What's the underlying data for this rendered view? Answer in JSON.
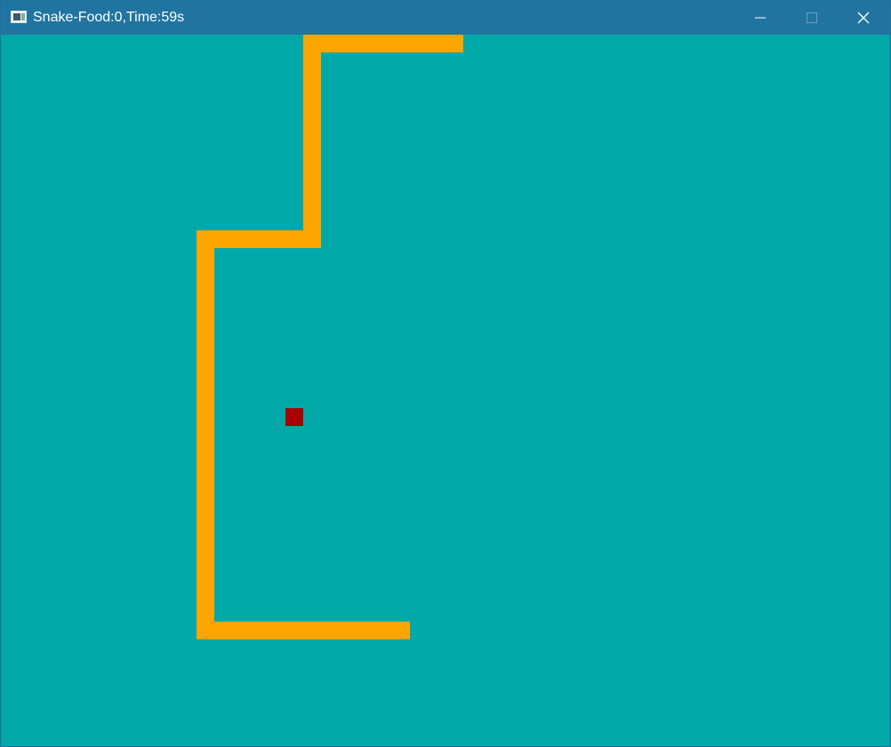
{
  "window": {
    "title": "Snake-Food:0,Time:59s",
    "icon": "app-window-icon",
    "controls": [
      "minimize-icon",
      "maximize-icon",
      "close-icon"
    ]
  },
  "colors": {
    "titlebar": "#2174A0",
    "background": "#00A8A8",
    "snake": "#FFA500",
    "food": "#A80000"
  }
}
